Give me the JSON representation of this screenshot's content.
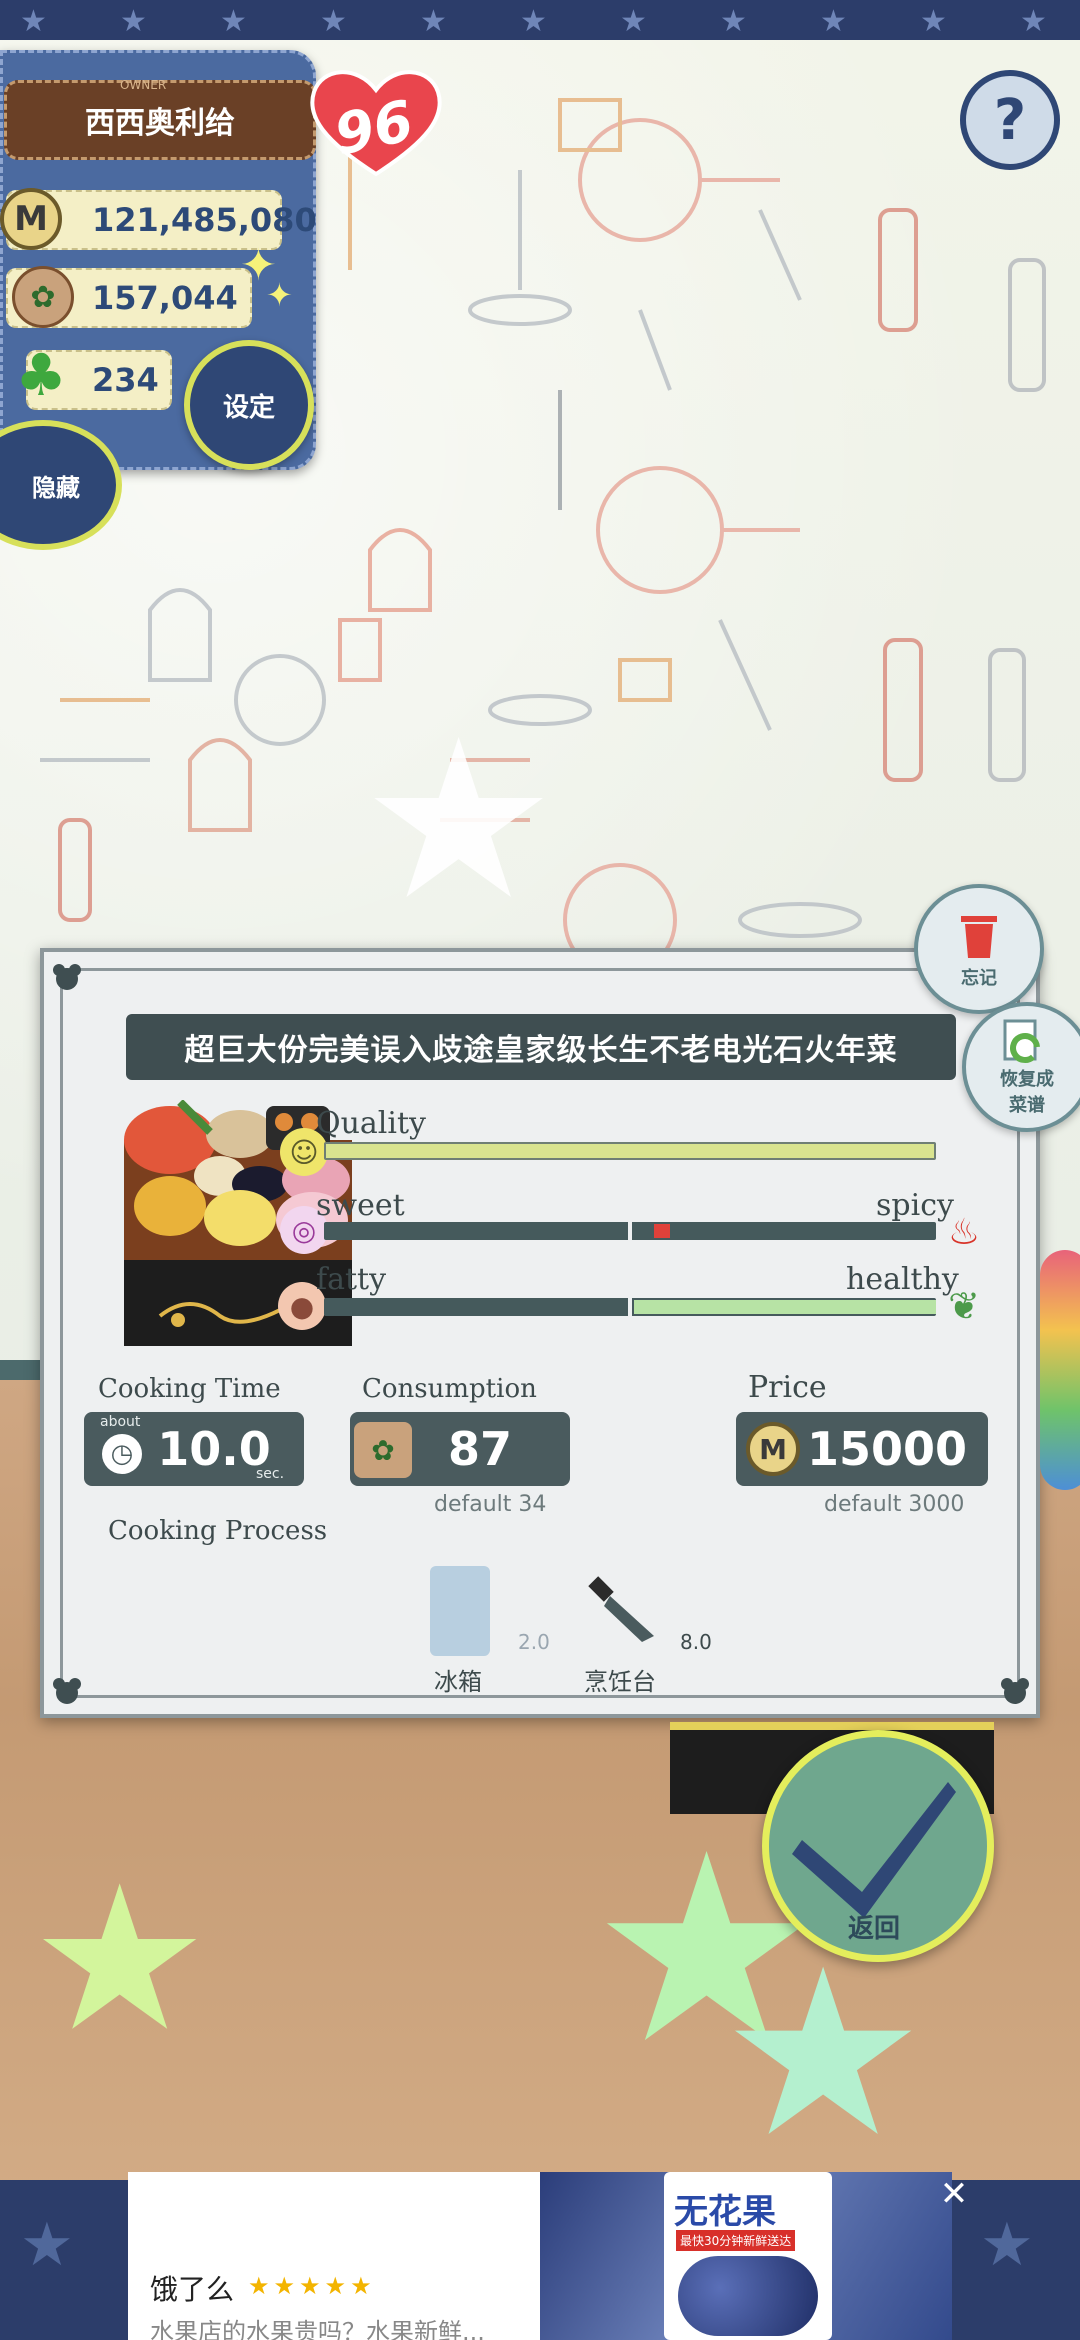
{
  "hud": {
    "owner_name": "西西奥利给",
    "owner_tag": "OWNER",
    "level": "96",
    "money": "121,485,080",
    "ingredients": "157,044",
    "clover": "234",
    "settings_label": "设定",
    "hide_label": "隐藏",
    "help_label": "?"
  },
  "recipe": {
    "title": "超巨大份完美误入歧途皇家级长生不老电光石火年菜",
    "quality_label": "Quality",
    "quality": 1.0,
    "sweet_label": "sweet",
    "spicy_label": "spicy",
    "taste_marker": 0.08,
    "fatty_label": "fatty",
    "healthy_label": "healthy",
    "healthy_level": 1.0,
    "cooking_time_label": "Cooking Time",
    "cooking_time_about": "about",
    "cooking_time": "10.0",
    "cooking_time_unit": "sec.",
    "consumption_label": "Consumption",
    "consumption": "87",
    "consumption_default": "default 34",
    "price_label": "Price",
    "price": "15000",
    "price_default": "default 3000",
    "process_label": "Cooking Process",
    "process": [
      {
        "name": "冰箱",
        "time": "2.0",
        "icon": "fridge-icon"
      },
      {
        "name": "烹饪台",
        "time": "8.0",
        "icon": "knife-icon"
      }
    ]
  },
  "side_buttons": {
    "forget": "忘记",
    "restore_line1": "恢复成",
    "restore_line2": "菜谱"
  },
  "confirm_label": "返回",
  "ad": {
    "title": "饿了么",
    "rating_stars": 5,
    "stars": "★★★★★",
    "description": "水果店的水果贵吗？水果新鲜...",
    "product_title": "无花果",
    "product_sub": "最快30分钟新鲜送达",
    "close": "✕"
  },
  "colors": {
    "hud_blue": "#4b6aa0",
    "quality_fill": "#d9e48f",
    "taste_marker": "#e0413a",
    "healthy_fill": "#b7e3a5",
    "dialog_bar": "#455a5c",
    "confirm_green": "#6fa78e"
  }
}
